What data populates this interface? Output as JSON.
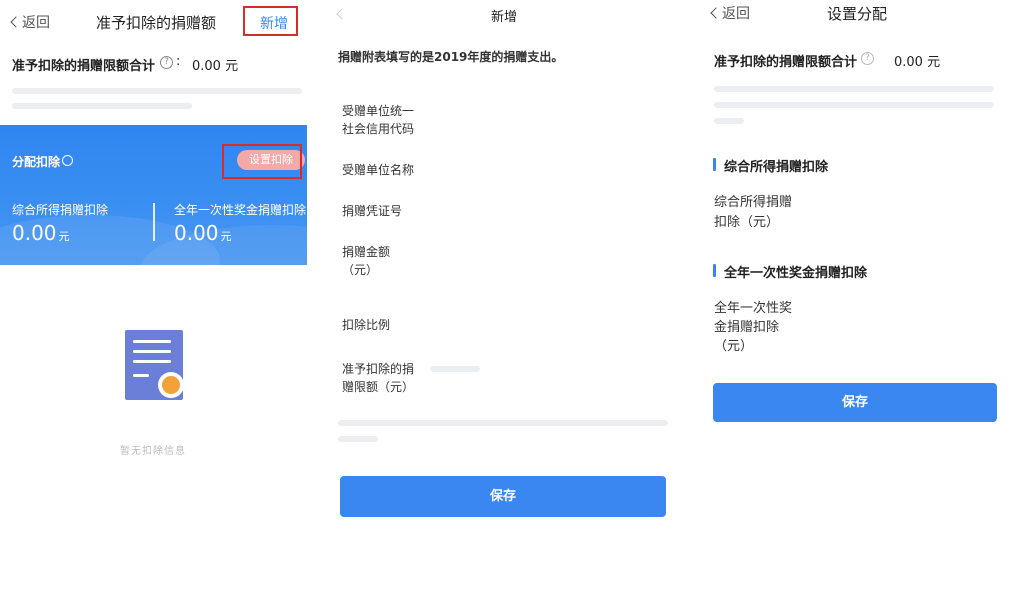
{
  "screen1": {
    "back_label": "返回",
    "title": "准予扣除的捐赠额",
    "add_label": "新增",
    "limit_label": "准予扣除的捐赠限额合计",
    "limit_value": "0.00 元",
    "card": {
      "title": "分配扣除",
      "set_button": "设置扣除",
      "left_label": "综合所得捐赠扣除",
      "left_value": "0.00",
      "right_label": "全年一次性奖金捐赠扣除",
      "right_value": "0.00",
      "unit": "元"
    },
    "empty_text": "暂无扣除信息"
  },
  "screen2": {
    "title": "新增",
    "notice": "捐赠附表填写的是2019年度的捐赠支出。",
    "fields": [
      {
        "label_l1": "受赠单位统一",
        "label_l2": "社会信用代码"
      },
      {
        "label_l1": "受赠单位名称",
        "label_l2": ""
      },
      {
        "label_l1": "捐赠凭证号",
        "label_l2": ""
      },
      {
        "label_l1": "捐赠金额",
        "label_l2": "（元）"
      },
      {
        "label_l1": "扣除比例",
        "label_l2": ""
      },
      {
        "label_l1": "准予扣除的捐",
        "label_l2": "赠限额（元）"
      }
    ],
    "save_label": "保存"
  },
  "screen3": {
    "back_label": "返回",
    "title": "设置分配",
    "limit_label": "准予扣除的捐赠限额合计",
    "limit_value": "0.00 元",
    "section1": "综合所得捐赠扣除",
    "field1_l1": "综合所得捐赠",
    "field1_l2": "扣除（元）",
    "section2": "全年一次性奖金捐赠扣除",
    "field2_l1": "全年一次性奖",
    "field2_l2": "金捐赠扣除",
    "field2_l3": "（元）",
    "save_label": "保存"
  },
  "colors": {
    "accent": "#3a87f1",
    "highlight": "#d82b2b",
    "card_bg": "#2f86f0"
  }
}
